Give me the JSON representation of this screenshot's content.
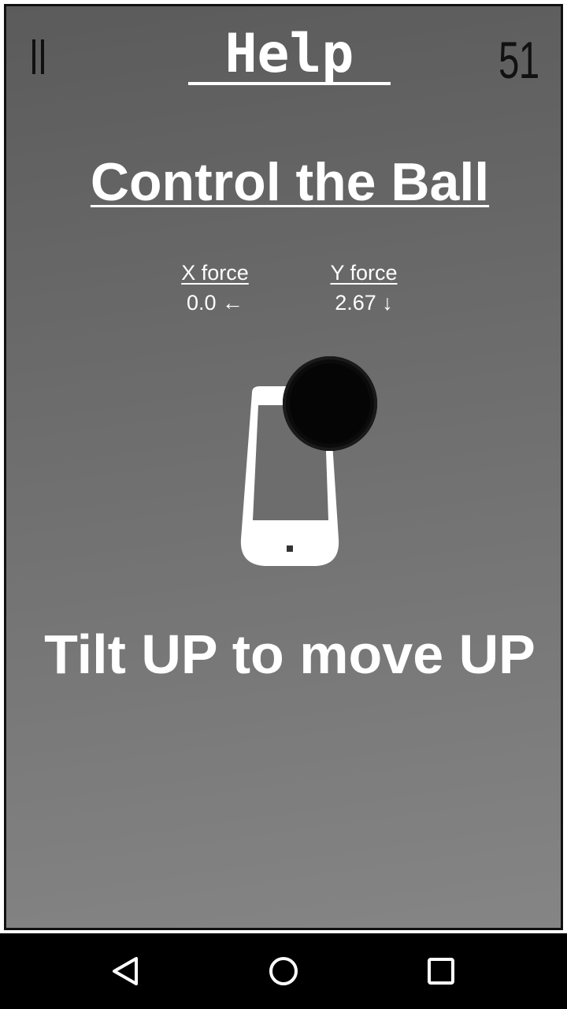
{
  "header": {
    "pause_icon": "pause-icon",
    "title": " Help ",
    "counter": "51"
  },
  "main": {
    "section_title": "Control the Ball",
    "x_force": {
      "label": "X force",
      "value": "0.0 ←"
    },
    "y_force": {
      "label": "Y force",
      "value": "2.67 ↓"
    },
    "illustration": {
      "icon": "phone-icon",
      "ball": "ball"
    },
    "instruction": "Tilt UP to move UP"
  },
  "navbar": {
    "back_icon": "back-triangle-icon",
    "home_icon": "home-circle-icon",
    "recents_icon": "recents-square-icon"
  },
  "colors": {
    "frame_gradient_top": "#5b5b5b",
    "frame_gradient_bottom": "#858585",
    "text": "#ffffff",
    "ball": "#050505",
    "navbar": "#000000"
  }
}
